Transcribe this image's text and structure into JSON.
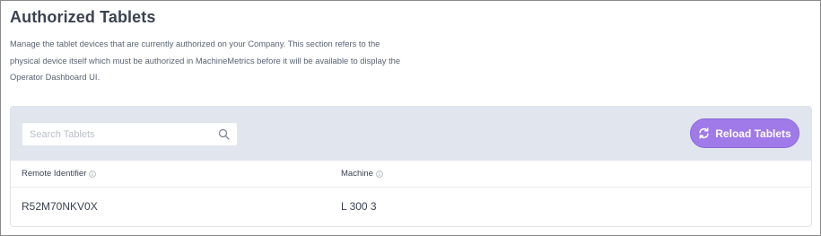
{
  "page": {
    "title": "Authorized Tablets",
    "description": "Manage the tablet devices that are currently authorized on your Company. This section refers to the physical device itself which must be authorized in MachineMetrics before it will be available to display the Operator Dashboard UI."
  },
  "toolbar": {
    "search_placeholder": "Search Tablets",
    "search_value": "",
    "reload_label": "Reload Tablets"
  },
  "table": {
    "columns": [
      {
        "label": "Remote Identifier",
        "icon": "info-icon"
      },
      {
        "label": "Machine",
        "icon": "info-icon"
      }
    ],
    "rows": [
      {
        "remote_identifier": "R52M70NKV0X",
        "machine": "L 300 3"
      }
    ]
  },
  "colors": {
    "accent": "#a07ae8",
    "toolbar_bg": "#e1e6ee",
    "text": "#3b4250"
  }
}
